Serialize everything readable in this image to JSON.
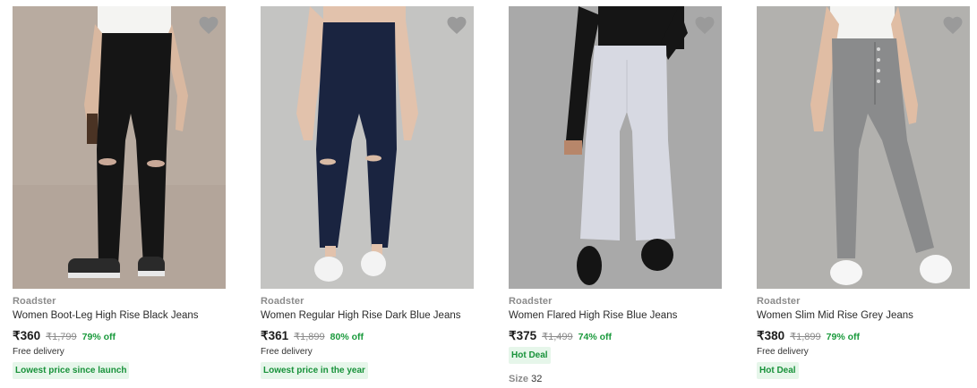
{
  "colors": {
    "accent_green": "#1a9a3c",
    "badge_bg": "#e6f6ea",
    "heart_fill": "#9a9a9a"
  },
  "products": [
    {
      "brand": "Roadster",
      "title": "Women Boot-Leg High Rise Black Jeans",
      "price": "₹360",
      "mrp": "₹1,799",
      "discount": "79% off",
      "delivery": "Free delivery",
      "badge": "Lowest price since launch",
      "wishlist_icon": "heart-icon"
    },
    {
      "brand": "Roadster",
      "title": "Women Regular High Rise Dark Blue Jeans",
      "price": "₹361",
      "mrp": "₹1,899",
      "discount": "80% off",
      "delivery": "Free delivery",
      "badge": "Lowest price in the year",
      "wishlist_icon": "heart-icon"
    },
    {
      "brand": "Roadster",
      "title": "Women Flared High Rise Blue Jeans",
      "price": "₹375",
      "mrp": "₹1,499",
      "discount": "74% off",
      "badge": "Hot Deal",
      "size_label": "Size",
      "size_value": "32",
      "wishlist_icon": "heart-icon"
    },
    {
      "brand": "Roadster",
      "title": "Women Slim Mid Rise Grey Jeans",
      "price": "₹380",
      "mrp": "₹1,899",
      "discount": "79% off",
      "delivery": "Free delivery",
      "badge": "Hot Deal",
      "wishlist_icon": "heart-icon"
    }
  ]
}
